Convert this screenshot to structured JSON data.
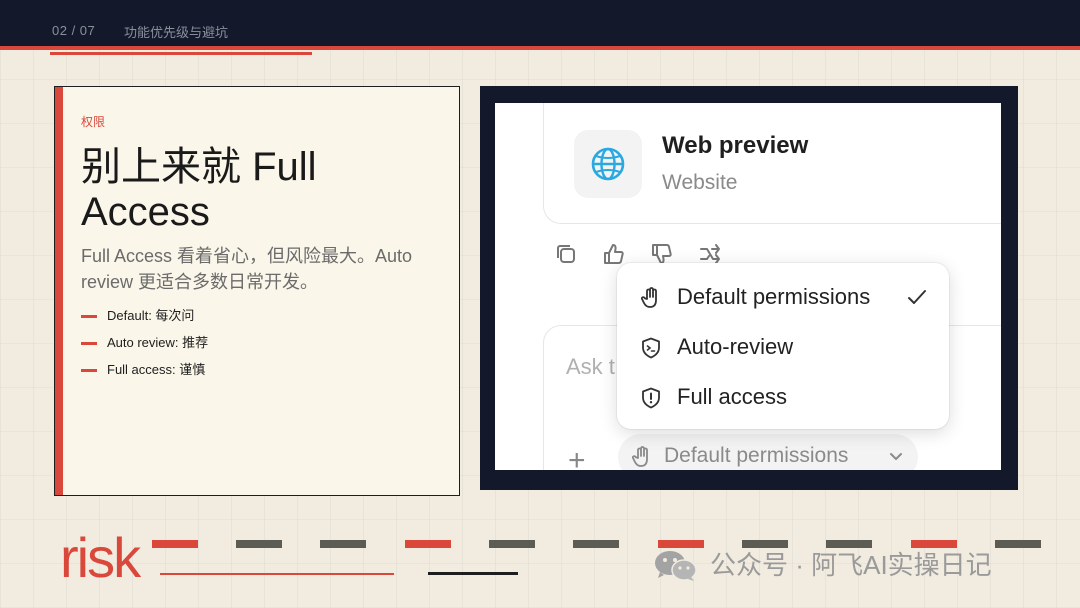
{
  "header": {
    "pager": "02 / 07",
    "section_title": "功能优先级与避坑"
  },
  "left_card": {
    "eyebrow": "权限",
    "headline": "别上来就 Full Access",
    "subtitle": "Full Access 看着省心，但风险最大。Auto review 更适合多数日常开发。",
    "bullets": [
      "Default: 每次问",
      "Auto review: 推荐",
      "Full access: 谨慎"
    ]
  },
  "screenshot": {
    "web_preview": {
      "title": "Web preview",
      "subtitle": "Website",
      "icon": "globe-icon"
    },
    "actions": [
      "copy-icon",
      "thumbs-up-icon",
      "thumbs-down-icon",
      "share-icon"
    ],
    "composer": {
      "placeholder": "Ask t",
      "add_icon": "plus-icon",
      "permission_selector": "Default permissions"
    },
    "permissions_menu": {
      "items": [
        {
          "label": "Default permissions",
          "icon": "hand-icon",
          "selected": true
        },
        {
          "label": "Auto-review",
          "icon": "shield-terminal-icon",
          "selected": false
        },
        {
          "label": "Full access",
          "icon": "shield-alert-icon",
          "selected": false
        }
      ]
    }
  },
  "footer": {
    "big_word": "risk",
    "watermark": "公众号 · 阿飞AI实操日记"
  },
  "colors": {
    "background": "#f1ebe0",
    "navy": "#13192b",
    "accent_red": "#d9483b",
    "dash_gray": "#5c5c54"
  }
}
